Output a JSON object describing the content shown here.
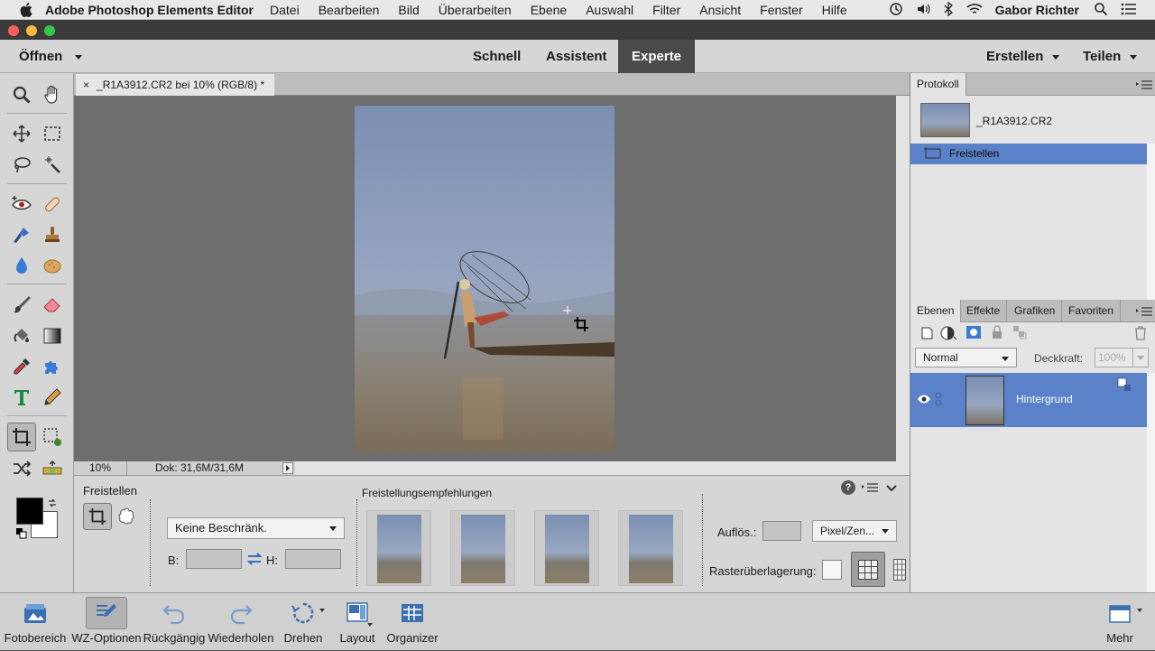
{
  "menubar": {
    "app_name": "Adobe Photoshop Elements Editor",
    "items": [
      "Datei",
      "Bearbeiten",
      "Bild",
      "Überarbeiten",
      "Ebene",
      "Auswahl",
      "Filter",
      "Ansicht",
      "Fenster",
      "Hilfe"
    ],
    "user": "Gabor Richter"
  },
  "modebar": {
    "open_label": "Öffnen",
    "modes": [
      "Schnell",
      "Assistent",
      "Experte"
    ],
    "active_mode": "Experte",
    "create_label": "Erstellen",
    "share_label": "Teilen"
  },
  "document": {
    "tab_title": "_R1A3912.CR2 bei 10% (RGB/8) *",
    "close_glyph": "×"
  },
  "status": {
    "zoom": "10%",
    "doc_size": "Dok: 31,6M/31,6M"
  },
  "tool_options": {
    "tool_name": "Freistellen",
    "constraint_value": "Keine Beschränk.",
    "width_label": "B:",
    "height_label": "H:",
    "recommendations_label": "Freistellungsempfehlungen",
    "resolution_label": "Auflös.:",
    "resolution_unit": "Pixel/Zen...",
    "grid_overlay_label": "Rasterüberlagerung:"
  },
  "history_panel": {
    "tab_label": "Protokoll",
    "items": [
      {
        "label": "_R1A3912.CR2",
        "selected": false
      },
      {
        "label": "Freistellen",
        "selected": true
      }
    ]
  },
  "layers_panel": {
    "tabs": [
      "Ebenen",
      "Effekte",
      "Grafiken",
      "Favoriten"
    ],
    "active_tab": "Ebenen",
    "blend_mode": "Normal",
    "opacity_label": "Deckkraft:",
    "opacity_value": "100%",
    "layers": [
      {
        "name": "Hintergrund",
        "visible": true
      }
    ]
  },
  "bottombar": {
    "items": [
      "Fotobereich",
      "WZ-Optionen",
      "Rückgängig",
      "Wiederholen",
      "Drehen",
      "Layout",
      "Organizer"
    ],
    "more_label": "Mehr"
  },
  "colors": {
    "accent_selected": "#5b82c9",
    "active_mode_bg": "#4a4a4a",
    "foreground_color": "#000000",
    "background_color": "#ffffff"
  }
}
